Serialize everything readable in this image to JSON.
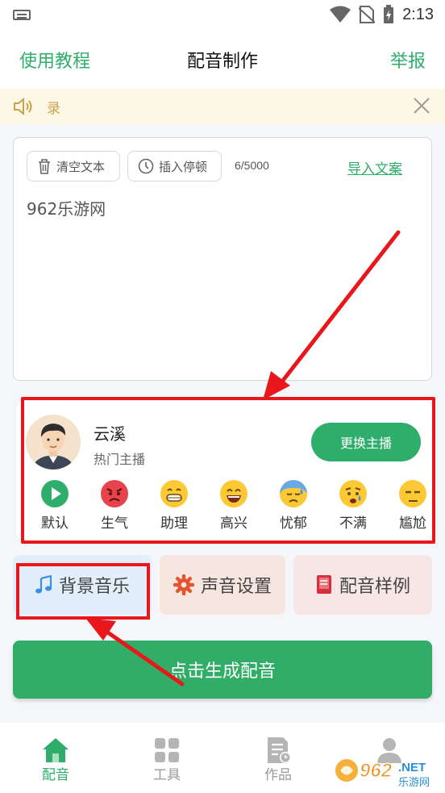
{
  "status": {
    "time": "2:13"
  },
  "header": {
    "tutorial": "使用教程",
    "title": "配音制作",
    "report": "举报"
  },
  "notice": {
    "text": "录"
  },
  "editor": {
    "clear_label": "清空文本",
    "pause_label": "插入停顿",
    "char_count": "6/5000",
    "import_label": "导入文案",
    "content": "962乐游网"
  },
  "host": {
    "name": "云溪",
    "subtitle": "热门主播",
    "switch_label": "更换主播",
    "emotions": [
      {
        "label": "默认",
        "icon": "play-icon"
      },
      {
        "label": "生气",
        "icon": "angry-face-icon"
      },
      {
        "label": "助理",
        "icon": "grin-face-icon"
      },
      {
        "label": "高兴",
        "icon": "happy-face-icon"
      },
      {
        "label": "忧郁",
        "icon": "sad-sweat-face-icon"
      },
      {
        "label": "不满",
        "icon": "worried-face-icon"
      },
      {
        "label": "尴尬",
        "icon": "unamused-face-icon"
      }
    ]
  },
  "features": {
    "bgm": "背景音乐",
    "voice_settings": "声音设置",
    "samples": "配音样例"
  },
  "generate_label": "点击生成配音",
  "tabs": [
    {
      "label": "配音",
      "icon": "home-icon",
      "active": true
    },
    {
      "label": "工具",
      "icon": "grid-icon",
      "active": false
    },
    {
      "label": "作品",
      "icon": "document-icon",
      "active": false
    },
    {
      "label": "",
      "icon": "profile-icon",
      "active": false
    }
  ],
  "watermark": {
    "number": "962",
    "domain": ".NET",
    "site": "乐游网"
  },
  "colors": {
    "accent": "#2fae6b",
    "highlight": "#e8171b",
    "notice_bg": "#fdf7e6"
  }
}
